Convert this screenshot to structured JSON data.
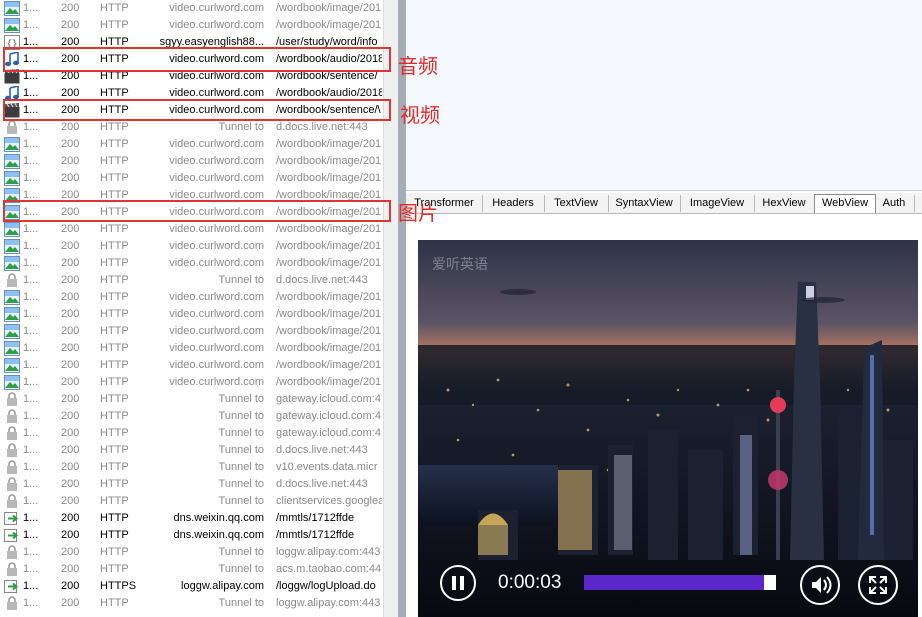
{
  "sessions": [
    {
      "num": "1...",
      "result": "200",
      "protocol": "HTTP",
      "host": "video.curlword.com",
      "url": "/wordbook/image/201",
      "icon": "image-icon",
      "active": false
    },
    {
      "num": "1...",
      "result": "200",
      "protocol": "HTTP",
      "host": "video.curlword.com",
      "url": "/wordbook/image/201",
      "icon": "image-icon",
      "active": false
    },
    {
      "num": "1...",
      "result": "200",
      "protocol": "HTTP",
      "host": "sgyy.easyenglish88...",
      "url": "/user/study/word/info",
      "icon": "json-icon",
      "active": true
    },
    {
      "num": "1...",
      "result": "200",
      "protocol": "HTTP",
      "host": "video.curlword.com",
      "url": "/wordbook/audio/2018",
      "icon": "audio-icon",
      "active": true
    },
    {
      "num": "1...",
      "result": "200",
      "protocol": "HTTP",
      "host": "video.curlword.com",
      "url": "/wordbook/sentence/",
      "icon": "video-icon",
      "active": true
    },
    {
      "num": "1...",
      "result": "200",
      "protocol": "HTTP",
      "host": "video.curlword.com",
      "url": "/wordbook/audio/2018",
      "icon": "audio-icon",
      "active": true
    },
    {
      "num": "1...",
      "result": "200",
      "protocol": "HTTP",
      "host": "video.curlword.com",
      "url": "/wordbook/sentence/\\",
      "icon": "video-icon",
      "active": true
    },
    {
      "num": "1...",
      "result": "200",
      "protocol": "HTTP",
      "host": "Tunnel to",
      "url": "d.docs.live.net:443",
      "icon": "lock-icon",
      "active": false
    },
    {
      "num": "1...",
      "result": "200",
      "protocol": "HTTP",
      "host": "video.curlword.com",
      "url": "/wordbook/image/201",
      "icon": "image-icon",
      "active": false
    },
    {
      "num": "1...",
      "result": "200",
      "protocol": "HTTP",
      "host": "video.curlword.com",
      "url": "/wordbook/image/201",
      "icon": "image-icon",
      "active": false
    },
    {
      "num": "1...",
      "result": "200",
      "protocol": "HTTP",
      "host": "video.curlword.com",
      "url": "/wordbook/image/201",
      "icon": "image-icon",
      "active": false
    },
    {
      "num": "1...",
      "result": "200",
      "protocol": "HTTP",
      "host": "video.curlword.com",
      "url": "/wordbook/image/201",
      "icon": "image-icon",
      "active": false
    },
    {
      "num": "1...",
      "result": "200",
      "protocol": "HTTP",
      "host": "video.curlword.com",
      "url": "/wordbook/image/201",
      "icon": "image-icon",
      "active": false
    },
    {
      "num": "1...",
      "result": "200",
      "protocol": "HTTP",
      "host": "video.curlword.com",
      "url": "/wordbook/image/201",
      "icon": "image-icon",
      "active": false
    },
    {
      "num": "1...",
      "result": "200",
      "protocol": "HTTP",
      "host": "video.curlword.com",
      "url": "/wordbook/image/201",
      "icon": "image-icon",
      "active": false
    },
    {
      "num": "1...",
      "result": "200",
      "protocol": "HTTP",
      "host": "video.curlword.com",
      "url": "/wordbook/image/201",
      "icon": "image-icon",
      "active": false
    },
    {
      "num": "1...",
      "result": "200",
      "protocol": "HTTP",
      "host": "Tunnel to",
      "url": "d.docs.live.net:443",
      "icon": "lock-icon",
      "active": false
    },
    {
      "num": "1...",
      "result": "200",
      "protocol": "HTTP",
      "host": "video.curlword.com",
      "url": "/wordbook/image/201",
      "icon": "image-icon",
      "active": false
    },
    {
      "num": "1...",
      "result": "200",
      "protocol": "HTTP",
      "host": "video.curlword.com",
      "url": "/wordbook/image/201",
      "icon": "image-icon",
      "active": false
    },
    {
      "num": "1...",
      "result": "200",
      "protocol": "HTTP",
      "host": "video.curlword.com",
      "url": "/wordbook/image/201",
      "icon": "image-icon",
      "active": false
    },
    {
      "num": "1...",
      "result": "200",
      "protocol": "HTTP",
      "host": "video.curlword.com",
      "url": "/wordbook/image/201",
      "icon": "image-icon",
      "active": false
    },
    {
      "num": "1...",
      "result": "200",
      "protocol": "HTTP",
      "host": "video.curlword.com",
      "url": "/wordbook/image/201",
      "icon": "image-icon",
      "active": false
    },
    {
      "num": "1...",
      "result": "200",
      "protocol": "HTTP",
      "host": "video.curlword.com",
      "url": "/wordbook/image/201",
      "icon": "image-icon",
      "active": false
    },
    {
      "num": "1...",
      "result": "200",
      "protocol": "HTTP",
      "host": "Tunnel to",
      "url": "gateway.icloud.com:4",
      "icon": "lock-icon",
      "active": false
    },
    {
      "num": "1...",
      "result": "200",
      "protocol": "HTTP",
      "host": "Tunnel to",
      "url": "gateway.icloud.com:4",
      "icon": "lock-icon",
      "active": false
    },
    {
      "num": "1...",
      "result": "200",
      "protocol": "HTTP",
      "host": "Tunnel to",
      "url": "gateway.icloud.com:4",
      "icon": "lock-icon",
      "active": false
    },
    {
      "num": "1...",
      "result": "200",
      "protocol": "HTTP",
      "host": "Tunnel to",
      "url": "d.docs.live.net:443",
      "icon": "lock-icon",
      "active": false
    },
    {
      "num": "1...",
      "result": "200",
      "protocol": "HTTP",
      "host": "Tunnel to",
      "url": "v10.events.data.micr",
      "icon": "lock-icon",
      "active": false
    },
    {
      "num": "1...",
      "result": "200",
      "protocol": "HTTP",
      "host": "Tunnel to",
      "url": "d.docs.live.net:443",
      "icon": "lock-icon",
      "active": false
    },
    {
      "num": "1...",
      "result": "200",
      "protocol": "HTTP",
      "host": "Tunnel to",
      "url": "clientservices.googlea",
      "icon": "lock-icon",
      "active": false
    },
    {
      "num": "1...",
      "result": "200",
      "protocol": "HTTP",
      "host": "dns.weixin.qq.com",
      "url": "/mmtls/1712ffde",
      "icon": "arrow-icon",
      "active": true
    },
    {
      "num": "1...",
      "result": "200",
      "protocol": "HTTP",
      "host": "dns.weixin.qq.com",
      "url": "/mmtls/1712ffde",
      "icon": "arrow-icon",
      "active": true
    },
    {
      "num": "1...",
      "result": "200",
      "protocol": "HTTP",
      "host": "Tunnel to",
      "url": "loggw.alipay.com:443",
      "icon": "lock-icon",
      "active": false
    },
    {
      "num": "1...",
      "result": "200",
      "protocol": "HTTP",
      "host": "Tunnel to",
      "url": "acs.m.taobao.com:44",
      "icon": "lock-icon",
      "active": false
    },
    {
      "num": "1...",
      "result": "200",
      "protocol": "HTTPS",
      "host": "loggw.alipay.com",
      "url": "/loggw/logUpload.do",
      "icon": "arrow-icon",
      "active": true
    },
    {
      "num": "1...",
      "result": "200",
      "protocol": "HTTP",
      "host": "Tunnel to",
      "url": "loggw.alipay.com:443",
      "icon": "lock-icon",
      "active": false
    }
  ],
  "inspector_tabs": [
    {
      "label": "Transformer",
      "selected": false
    },
    {
      "label": "Headers",
      "selected": false
    },
    {
      "label": "TextView",
      "selected": false
    },
    {
      "label": "SyntaxView",
      "selected": false
    },
    {
      "label": "ImageView",
      "selected": false
    },
    {
      "label": "HexView",
      "selected": false
    },
    {
      "label": "WebView",
      "selected": true
    },
    {
      "label": "Auth",
      "selected": false
    }
  ],
  "player": {
    "watermark": "爱听英语",
    "time": "0:00:03",
    "progress": 0.94,
    "progress_color": "#5b27c9"
  },
  "annotations": {
    "audio": "音频",
    "video": "视频",
    "image": "图片",
    "color": "#e13535"
  }
}
